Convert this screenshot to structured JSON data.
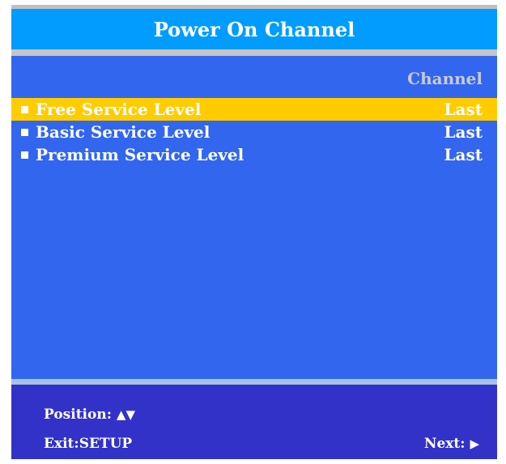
{
  "title": "Power On Channel",
  "column_header": "Channel",
  "items": [
    {
      "label": "Free Service Level",
      "value": "Last",
      "selected": true
    },
    {
      "label": "Basic Service Level",
      "value": "Last",
      "selected": false
    },
    {
      "label": "Premium Service Level",
      "value": "Last",
      "selected": false
    }
  ],
  "footer": {
    "position_label": "Position:",
    "position_up_glyph": "▲",
    "position_down_glyph": "▼",
    "exit_label": "Exit:",
    "exit_key": "SETUP",
    "next_label": "Next:",
    "next_glyph": "▶"
  },
  "colors": {
    "title_bar": "#009cff",
    "main_background": "#3366ee",
    "selected_row": "#ffcc00",
    "footer_background": "#3232c8",
    "column_header_text": "#c8cbd6"
  },
  "icons": {
    "bullet": "square-bullet-icon",
    "up": "up-arrow-icon",
    "down": "down-arrow-icon",
    "next": "right-arrow-icon"
  }
}
